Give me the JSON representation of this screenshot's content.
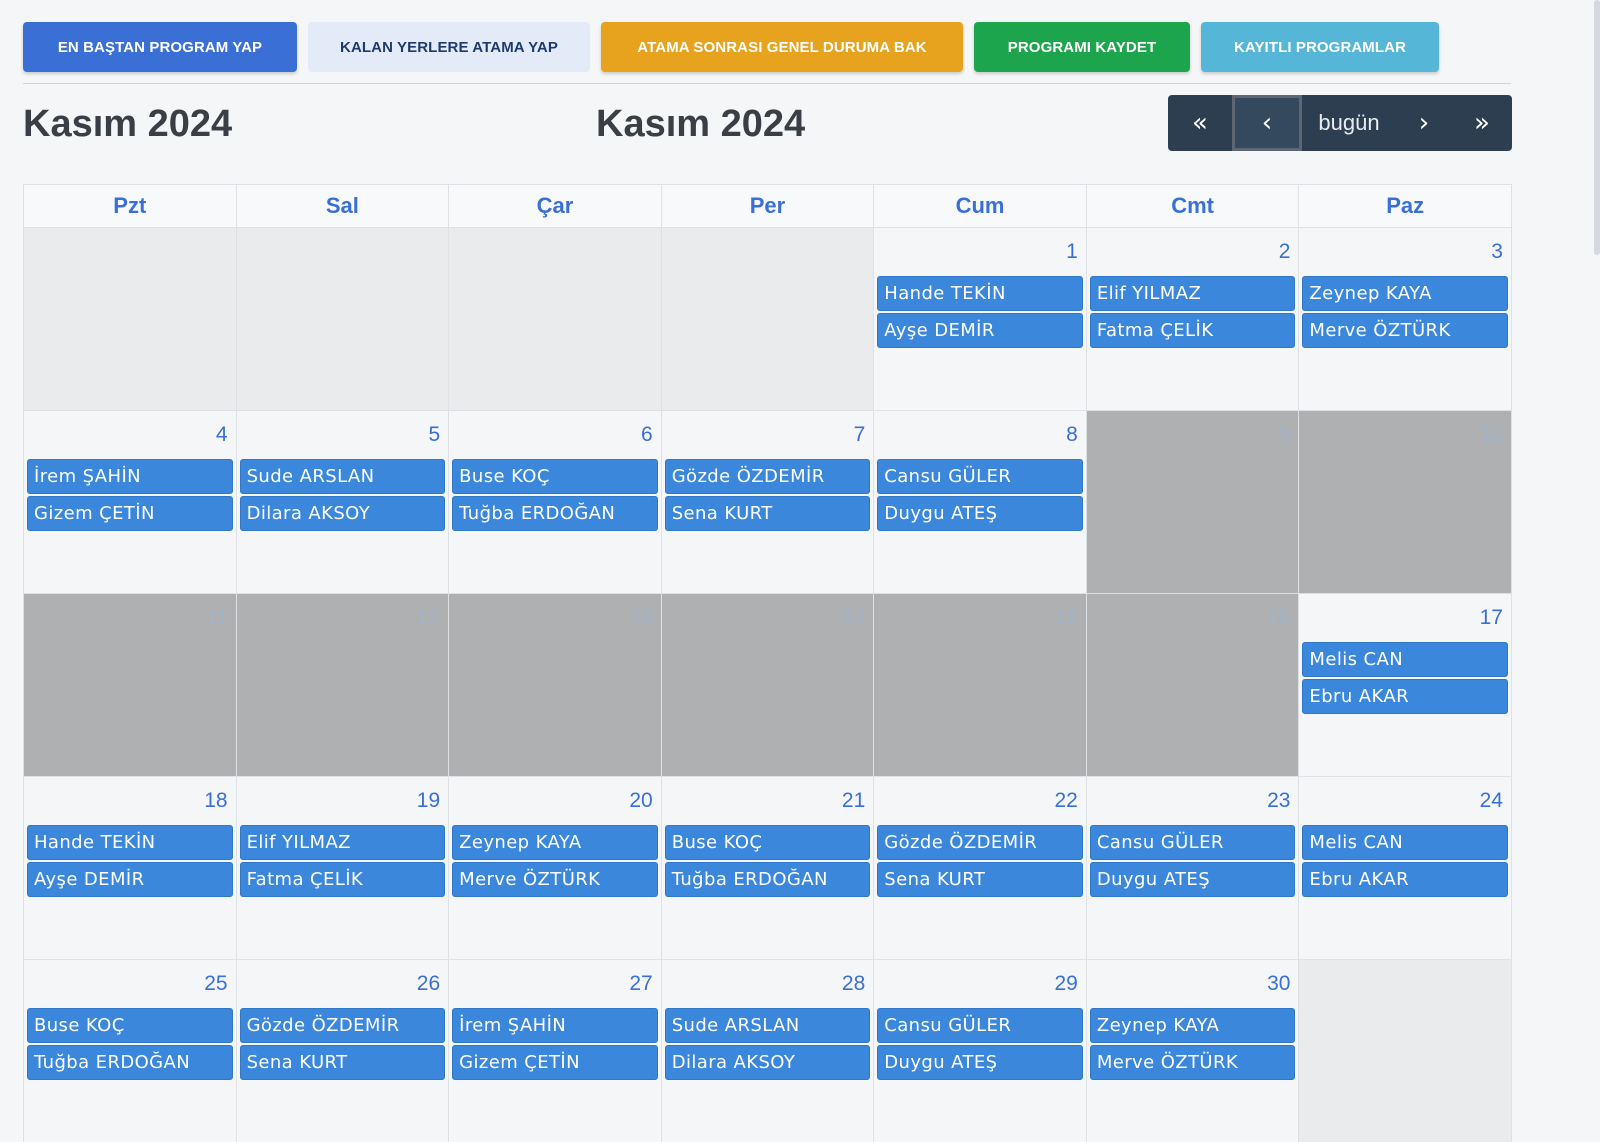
{
  "toolbar": {
    "restart": "EN BAŞTAN PROGRAM YAP",
    "assign_remaining": "KALAN YERLERE ATAMA YAP",
    "overview": "ATAMA SONRASI GENEL DURUMA BAK",
    "save": "PROGRAMI KAYDET",
    "saved": "KAYITLI PROGRAMLAR"
  },
  "header": {
    "title_left": "Kasım 2024",
    "title_center": "Kasım 2024"
  },
  "nav": {
    "first": "«",
    "prev": "‹",
    "today": "bugün",
    "next": "›",
    "last": "»"
  },
  "weekdays": [
    "Pzt",
    "Sal",
    "Çar",
    "Per",
    "Cum",
    "Cmt",
    "Paz"
  ],
  "weeks": [
    [
      {
        "day": "",
        "type": "out",
        "events": []
      },
      {
        "day": "",
        "type": "out",
        "events": []
      },
      {
        "day": "",
        "type": "out",
        "events": []
      },
      {
        "day": "",
        "type": "out",
        "events": []
      },
      {
        "day": "1",
        "type": "normal",
        "events": [
          "Hande TEKİN",
          "Ayşe DEMİR"
        ]
      },
      {
        "day": "2",
        "type": "normal",
        "events": [
          "Elif YILMAZ",
          "Fatma ÇELİK"
        ]
      },
      {
        "day": "3",
        "type": "normal",
        "events": [
          "Zeynep KAYA",
          "Merve ÖZTÜRK"
        ]
      }
    ],
    [
      {
        "day": "4",
        "type": "normal",
        "events": [
          "İrem ŞAHİN",
          "Gizem ÇETİN"
        ]
      },
      {
        "day": "5",
        "type": "normal",
        "events": [
          "Sude ARSLAN",
          "Dilara AKSOY"
        ]
      },
      {
        "day": "6",
        "type": "normal",
        "events": [
          "Buse KOÇ",
          "Tuğba ERDOĞAN"
        ]
      },
      {
        "day": "7",
        "type": "normal",
        "events": [
          "Gözde ÖZDEMİR",
          "Sena KURT"
        ]
      },
      {
        "day": "8",
        "type": "normal",
        "events": [
          "Cansu GÜLER",
          "Duygu ATEŞ"
        ]
      },
      {
        "day": "9",
        "type": "off",
        "events": []
      },
      {
        "day": "10",
        "type": "off",
        "events": []
      }
    ],
    [
      {
        "day": "11",
        "type": "off",
        "events": []
      },
      {
        "day": "12",
        "type": "off",
        "events": []
      },
      {
        "day": "13",
        "type": "off",
        "events": []
      },
      {
        "day": "14",
        "type": "off",
        "events": []
      },
      {
        "day": "15",
        "type": "off",
        "events": []
      },
      {
        "day": "16",
        "type": "off",
        "events": []
      },
      {
        "day": "17",
        "type": "normal",
        "events": [
          "Melis CAN",
          "Ebru AKAR"
        ]
      }
    ],
    [
      {
        "day": "18",
        "type": "normal",
        "events": [
          "Hande TEKİN",
          "Ayşe DEMİR"
        ]
      },
      {
        "day": "19",
        "type": "normal",
        "events": [
          "Elif YILMAZ",
          "Fatma ÇELİK"
        ]
      },
      {
        "day": "20",
        "type": "normal",
        "events": [
          "Zeynep KAYA",
          "Merve ÖZTÜRK"
        ]
      },
      {
        "day": "21",
        "type": "normal",
        "events": [
          "Buse KOÇ",
          "Tuğba ERDOĞAN"
        ]
      },
      {
        "day": "22",
        "type": "normal",
        "events": [
          "Gözde ÖZDEMİR",
          "Sena KURT"
        ]
      },
      {
        "day": "23",
        "type": "normal",
        "events": [
          "Cansu GÜLER",
          "Duygu ATEŞ"
        ]
      },
      {
        "day": "24",
        "type": "normal",
        "events": [
          "Melis CAN",
          "Ebru AKAR"
        ]
      }
    ],
    [
      {
        "day": "25",
        "type": "normal",
        "events": [
          "Buse KOÇ",
          "Tuğba ERDOĞAN"
        ]
      },
      {
        "day": "26",
        "type": "normal",
        "events": [
          "Gözde ÖZDEMİR",
          "Sena KURT"
        ]
      },
      {
        "day": "27",
        "type": "normal",
        "events": [
          "İrem ŞAHİN",
          "Gizem ÇETİN"
        ]
      },
      {
        "day": "28",
        "type": "normal",
        "events": [
          "Sude ARSLAN",
          "Dilara AKSOY"
        ]
      },
      {
        "day": "29",
        "type": "normal",
        "events": [
          "Cansu GÜLER",
          "Duygu ATEŞ"
        ]
      },
      {
        "day": "30",
        "type": "normal",
        "events": [
          "Zeynep KAYA",
          "Merve ÖZTÜRK"
        ]
      },
      {
        "day": "",
        "type": "out",
        "events": []
      }
    ]
  ]
}
